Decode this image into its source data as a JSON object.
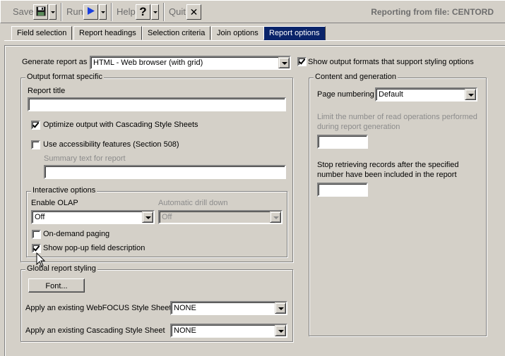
{
  "toolbar": {
    "save_label": "Save",
    "run_label": "Run",
    "help_label": "Help",
    "help_glyph": "?",
    "quit_label": "Quit",
    "quit_glyph": "✕",
    "status_text": "Reporting from file: CENTORD"
  },
  "tabs": [
    {
      "label": "Field selection",
      "active": false
    },
    {
      "label": "Report headings",
      "active": false
    },
    {
      "label": "Selection criteria",
      "active": false
    },
    {
      "label": "Join options",
      "active": false
    },
    {
      "label": "Report options",
      "active": true
    }
  ],
  "report_options": {
    "generate_label": "Generate report as",
    "generate_value": "HTML - Web browser (with grid)",
    "show_output_formats_label": "Show output formats that support styling options",
    "show_output_formats_checked": true,
    "output_format": {
      "title": "Output format specific",
      "report_title_label": "Report title",
      "report_title_value": "",
      "optimize_css_label": "Optimize output with Cascading Style Sheets",
      "optimize_css_checked": true,
      "accessibility_label": "Use accessibility features (Section 508)",
      "accessibility_checked": false,
      "summary_label": "Summary text for report",
      "summary_value": ""
    },
    "interactive": {
      "title": "Interactive options",
      "enable_olap_label": "Enable OLAP",
      "enable_olap_value": "Off",
      "auto_drill_label": "Automatic drill down",
      "auto_drill_value": "Off",
      "on_demand_label": "On-demand paging",
      "on_demand_checked": false,
      "popup_label": "Show pop-up field description",
      "popup_checked": true
    },
    "global_styling": {
      "title": "Global report styling",
      "font_button": "Font...",
      "webfocus_label": "Apply an existing WebFOCUS Style Sheet",
      "webfocus_value": "NONE",
      "css_label": "Apply an existing Cascading Style Sheet",
      "css_value": "NONE"
    },
    "content": {
      "title": "Content and generation",
      "page_numbering_label": "Page numbering",
      "page_numbering_value": "Default",
      "limit_reads_label_1": "Limit the number of read operations performed",
      "limit_reads_label_2": "during report generation",
      "limit_reads_value": "",
      "stop_label_1": "Stop retrieving records after the specified",
      "stop_label_2": "number have been included in the report",
      "stop_value": ""
    }
  }
}
